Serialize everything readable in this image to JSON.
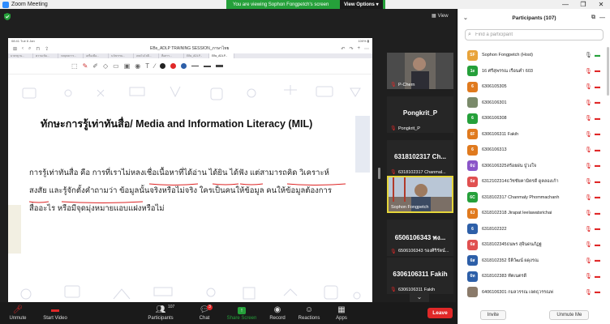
{
  "window": {
    "title": "Zoom Meeting",
    "controls": [
      "—",
      "❐",
      "✕"
    ]
  },
  "banner": {
    "text": "You are viewing Sophon Fongpetch's screen",
    "options": "View Options ▾"
  },
  "meeting": {
    "view_label": "View"
  },
  "tablet": {
    "status_left": "08:41  Tue 6 Jan",
    "status_right": "100% ▮",
    "doc_title": "EBs_ADLP TRAINING SESSION_ภาษาไทย",
    "tabs": [
      "มาตรฐาน...",
      "ความเข้ม...",
      "กลยุทธการ...",
      "เครื่องมือ...",
      "นวัตกรรม...",
      "เทคโนโลยี...",
      "สื่อสาร...",
      "EBs_ADLP..."
    ],
    "active_tab": "EBs_ADLP..."
  },
  "slide": {
    "title": "ทักษะการรู้เท่าทันสื่อ/ Media and Information Literacy (MIL)",
    "body": [
      "การรู้เท่าทันสื่อ คือ การที่เราไม่หลงเชื่อเนื้อหาที่ได้อ่าน ได้ยิน ได้ฟัง แต่สามารถคิด วิเคราะห์",
      "สงสัย และรู้จักตั้งคำถามว่า ข้อมูลนั้นจริงหรือไม่จริง ใครเป็นคนให้ข้อมูล คนให้ข้อมูลต้องการ",
      "สื่ออะไร หรือมีจุดมุ่งหมายแอบแฝงหรือไม่"
    ]
  },
  "tiles": [
    {
      "name": "P-Chern",
      "big": ""
    },
    {
      "name": "Pongkrit_P",
      "big": "Pongkrit_P"
    },
    {
      "name": "6318102317 Chanmal...",
      "big": "6318102317 Ch..."
    },
    {
      "name": "Sophon Fongpetch",
      "big": ""
    },
    {
      "name": "6506106343 รองศิริรัตน์...",
      "big": "6506106343 พง..."
    },
    {
      "name": "6306106311 Fakih",
      "big": "6306106311 Fakih"
    }
  ],
  "toolbar": {
    "unmute": "Unmute",
    "start_video": "Start Video",
    "participants": "Participants",
    "participants_count": "107",
    "chat": "Chat",
    "chat_badge": "3",
    "share_screen": "Share Screen",
    "record": "Record",
    "reactions": "Reactions",
    "apps": "Apps",
    "leave": "Leave"
  },
  "panel": {
    "title": "Participants (107)",
    "search_placeholder": "Find a participant",
    "invite": "Invite",
    "unmute_me": "Unmute Me",
    "participants": [
      {
        "initials": "SF",
        "name": "Sophon Fongpetch (Host)",
        "color": "#e8a33a",
        "mic": "on",
        "video": "on"
      },
      {
        "initials": "1e",
        "name": "16 ศรีสุพรรณ เรือนคำ 603",
        "color": "#25a03a",
        "mic": "off",
        "video": "off"
      },
      {
        "initials": "6",
        "name": "6306105305",
        "color": "#e07a1e",
        "mic": "off",
        "video": "off"
      },
      {
        "initials": "img",
        "name": "6306106301",
        "color": "#7a8a6a",
        "mic": "off",
        "video": "off"
      },
      {
        "initials": "6",
        "name": "6306106308",
        "color": "#25a03a",
        "mic": "off",
        "video": "off"
      },
      {
        "initials": "6F",
        "name": "6306106311 Fakih",
        "color": "#e07a1e",
        "mic": "off",
        "video": "off"
      },
      {
        "initials": "6",
        "name": "6306106313",
        "color": "#e07a1e",
        "mic": "off",
        "video": "off"
      },
      {
        "initials": "6ป",
        "name": "6306106325สร้อยฝน ปู่วงใจ",
        "color": "#8a55c8",
        "mic": "off",
        "video": "off"
      },
      {
        "initials": "6ส",
        "name": "6312102314ธวัชชัยคามิตรดี ดูคลองเก้า",
        "color": "#e05050",
        "mic": "off",
        "video": "off"
      },
      {
        "initials": "6C",
        "name": "6318102317 Chanmaly Phommachanh",
        "color": "#25a03a",
        "mic": "off",
        "video": "off"
      },
      {
        "initials": "6J",
        "name": "6318102318 Jirapat leelawatsrichai",
        "color": "#e07a1e",
        "mic": "off",
        "video": "off"
      },
      {
        "initials": "6",
        "name": "6318102322",
        "color": "#2d5fa8",
        "mic": "off",
        "video": "off"
      },
      {
        "initials": "6ส",
        "name": "6318102345ธนพร สุจินดนภัฏฐ",
        "color": "#e05050",
        "mic": "off",
        "video": "off"
      },
      {
        "initials": "6ส",
        "name": "6318102352 ธิติวัฒน์ ผดุงรณ",
        "color": "#2d5fa8",
        "mic": "off",
        "video": "off"
      },
      {
        "initials": "6ท",
        "name": "6318102383 ทัตเนตรดี",
        "color": "#2d5fa8",
        "mic": "off",
        "video": "off"
      },
      {
        "initials": "img",
        "name": "6406106301 กมลวรรณ เจตธุวรรณพ่",
        "color": "#8a7a6a",
        "mic": "off",
        "video": "off"
      }
    ]
  }
}
